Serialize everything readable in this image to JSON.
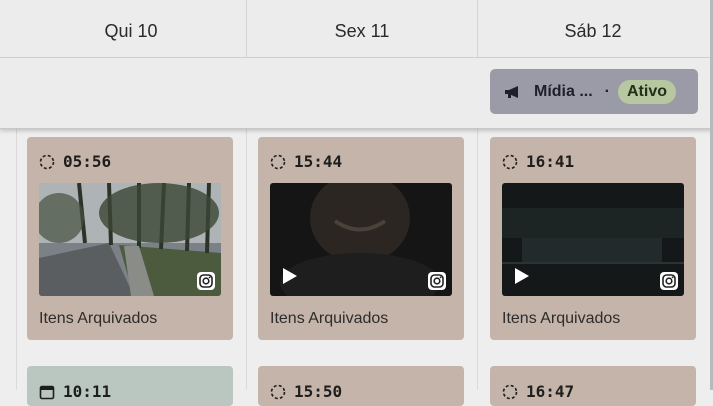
{
  "days": [
    "Qui 10",
    "Sex 11",
    "Sáb 12"
  ],
  "banner": {
    "label": "Mídia ...",
    "separator": "·",
    "status": "Ativo"
  },
  "cards": [
    {
      "time": "05:56",
      "caption": "Itens Arquivados",
      "icon": "loading-circle-icon",
      "media": "road-photo",
      "video": false
    },
    {
      "time": "15:44",
      "caption": "Itens Arquivados",
      "icon": "loading-circle-icon",
      "media": "dark-video",
      "video": true
    },
    {
      "time": "16:41",
      "caption": "Itens Arquivados",
      "icon": "loading-circle-icon",
      "media": "dark-pool-video",
      "video": true
    }
  ],
  "next_row": [
    {
      "time": "10:11",
      "icon": "calendar-icon"
    },
    {
      "time": "15:50",
      "icon": "loading-circle-icon"
    },
    {
      "time": "16:47",
      "icon": "loading-circle-icon"
    }
  ],
  "colors": {
    "card_bg": "#c4b4aa",
    "card_bg_alt": "#b9c7c0",
    "banner_bg": "#9b9ba8",
    "status_pill": "#b7c8a0"
  }
}
